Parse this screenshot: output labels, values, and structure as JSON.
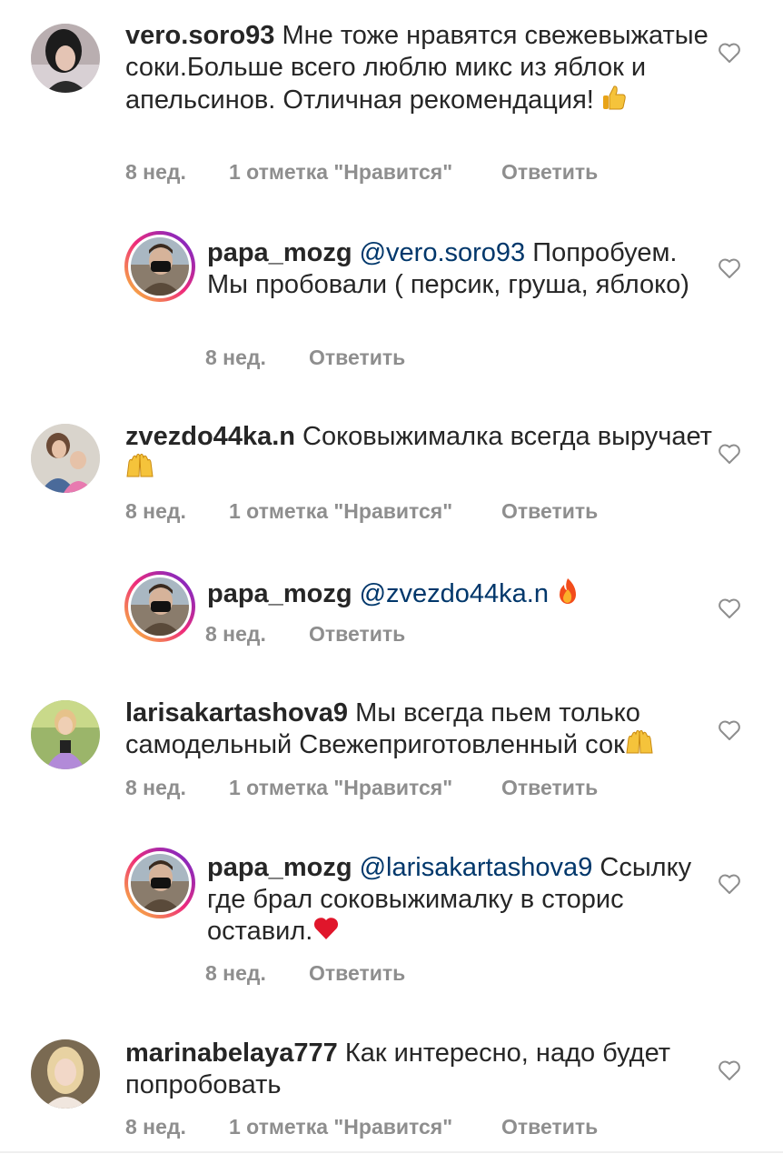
{
  "comments": [
    {
      "username": "vero.soro93",
      "text": "Мне тоже нравятся свежевыжатые соки.Больше всего люблю микс из яблок и апельсинов. Отличная рекомендация!",
      "emoji": "thumbs-up",
      "time": "8 нед.",
      "likes": "1 отметка \"Нравится\"",
      "reply": "Ответить"
    },
    {
      "username": "papa_mozg",
      "mention": "@vero.soro93",
      "text": "Попробуем. Мы пробовали ( персик, груша, яблоко)",
      "time": "8 нед.",
      "reply": "Ответить"
    },
    {
      "username": "zvezdo44ka.n",
      "text": "Соковыжималка всегда выручает",
      "emoji": "raising-hands",
      "time": "8 нед.",
      "likes": "1 отметка \"Нравится\"",
      "reply": "Ответить"
    },
    {
      "username": "papa_mozg",
      "mention": "@zvezdo44ka.n",
      "emoji": "fire",
      "time": "8 нед.",
      "reply": "Ответить"
    },
    {
      "username": "larisakartashova9",
      "text": "Мы всегда пьем только самодельный Свежеприготовленный сок",
      "emoji": "raising-hands",
      "time": "8 нед.",
      "likes": "1 отметка \"Нравится\"",
      "reply": "Ответить"
    },
    {
      "username": "papa_mozg",
      "mention": "@larisakartashova9",
      "text": "Ссылку где брал соковыжималку в сторис оставил.",
      "emoji": "red-heart",
      "time": "8 нед.",
      "reply": "Ответить"
    },
    {
      "username": "marinabelaya777",
      "text": "Как интересно, надо будет попробовать",
      "time": "8 нед.",
      "likes": "1 отметка \"Нравится\"",
      "reply": "Ответить"
    }
  ],
  "colors": {
    "text": "#262626",
    "secondary": "#8e8e8e",
    "mention": "#00376b"
  }
}
